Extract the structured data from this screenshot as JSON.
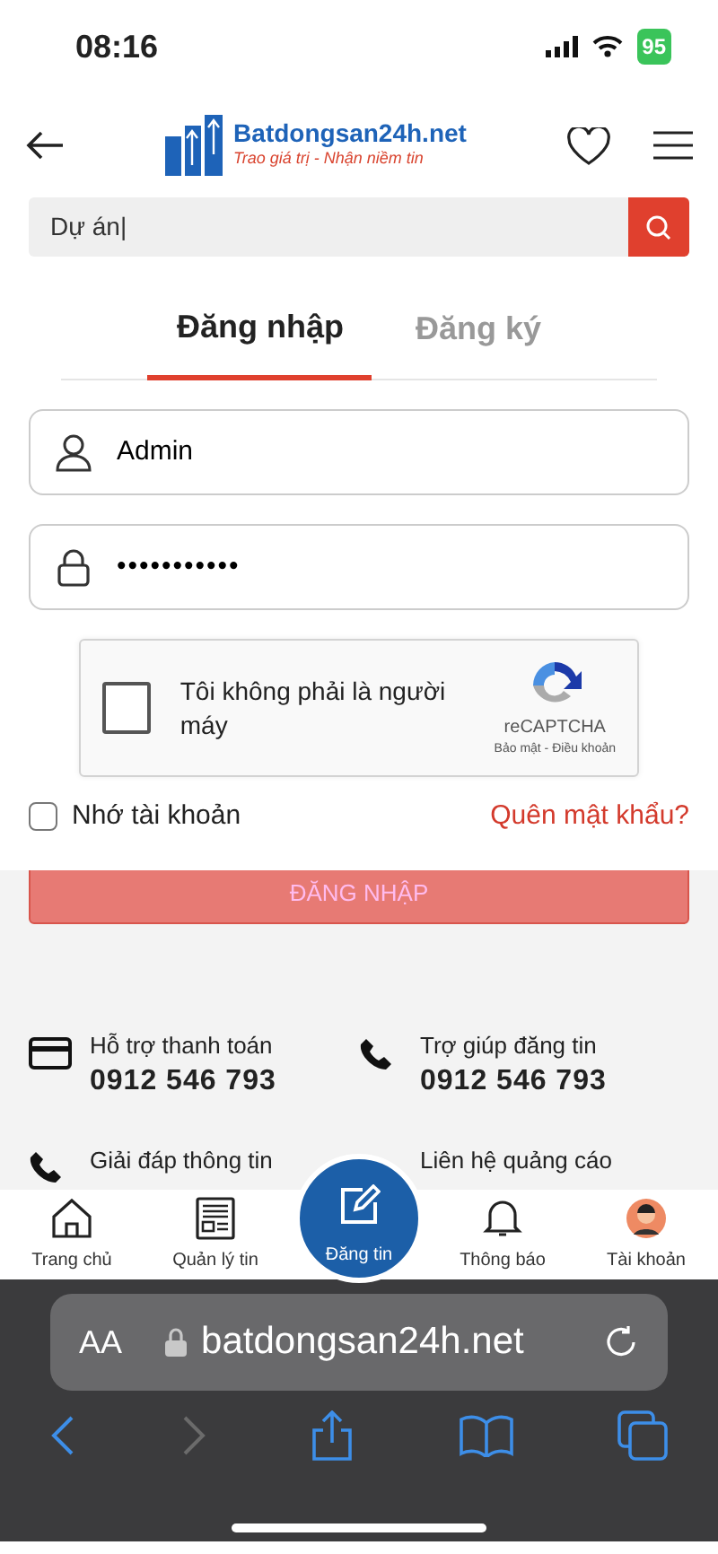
{
  "status_bar": {
    "time": "08:16",
    "battery": "95"
  },
  "header": {
    "logo_title": "Batdongsan24h.net",
    "logo_tagline": "Trao giá trị - Nhận niềm tin"
  },
  "search": {
    "value": "Dự án|"
  },
  "tabs": [
    {
      "label": "Đăng nhập",
      "selected": true
    },
    {
      "label": "Đăng ký",
      "selected": false
    }
  ],
  "fields": [
    {
      "kind": "user",
      "value": "Admin"
    },
    {
      "kind": "password",
      "value": "•••••••••••"
    }
  ],
  "captcha": {
    "label": "Tôi không phải là người máy",
    "checked": false,
    "brand": "reCAPTCHA",
    "links": "Bảo mật - Điều khoản"
  },
  "remember": {
    "label": "Nhớ tài khoản",
    "checked": false
  },
  "forgot_link": "Quên mật khẩu?",
  "login_button": {
    "label": "ĐĂNG NHẬP",
    "disabled": true
  },
  "support": [
    {
      "kind": "card",
      "label": "Hỗ trợ thanh toán",
      "phone": "0912 546 793"
    },
    {
      "kind": "phone",
      "label": "Trợ giúp đăng tin",
      "phone": "0912 546 793"
    },
    {
      "kind": "phone",
      "label": "Giải đáp thông tin"
    },
    {
      "kind": "none",
      "label": "Liên hệ quảng cáo"
    }
  ],
  "bottom_nav": [
    {
      "kind": "home",
      "label": "Trang chủ"
    },
    {
      "kind": "news",
      "label": "Quản lý tin"
    },
    {
      "kind": "post",
      "label": "Đăng tin"
    },
    {
      "kind": "bell",
      "label": "Thông báo"
    },
    {
      "kind": "avatar",
      "label": "Tài khoản"
    }
  ],
  "browser": {
    "text_size": "AA",
    "url": "batdongsan24h.net",
    "back_disabled": false,
    "forward_disabled": true
  }
}
